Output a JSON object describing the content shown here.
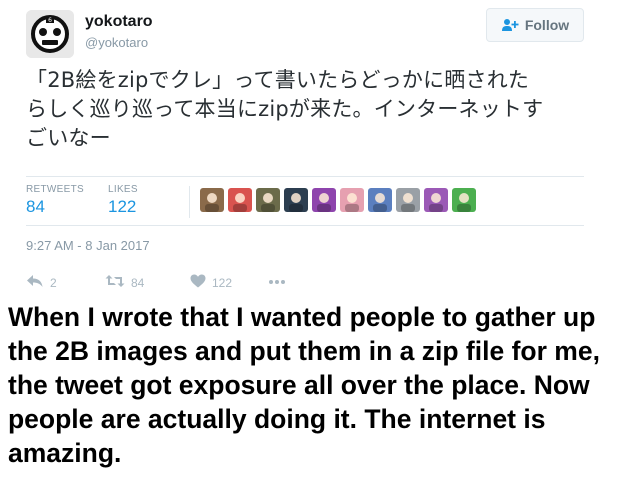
{
  "tweet": {
    "author": {
      "display_name": "yokotaro",
      "handle": "@yokotaro",
      "avatar_icon": "masked-face-avatar"
    },
    "follow_label": "Follow",
    "text_lines": [
      "「2B絵をzipでクレ」って書いたらどっかに晒された",
      "らしく巡り巡って本当にzipが来た。インターネットす",
      "ごいなー"
    ],
    "stats": {
      "retweets_label": "RETWEETS",
      "retweets_count": "84",
      "likes_label": "LIKES",
      "likes_count": "122"
    },
    "liker_avatars": [
      {
        "icon": "liker-avatar-1",
        "color": "#8a6a4a"
      },
      {
        "icon": "liker-avatar-2",
        "color": "#d9534f"
      },
      {
        "icon": "liker-avatar-3",
        "color": "#6b6b4a"
      },
      {
        "icon": "liker-avatar-4",
        "color": "#2c3e50"
      },
      {
        "icon": "liker-avatar-5",
        "color": "#8e44ad"
      },
      {
        "icon": "liker-avatar-6",
        "color": "#e6a0b0"
      },
      {
        "icon": "liker-avatar-7",
        "color": "#5b7fbf"
      },
      {
        "icon": "liker-avatar-8",
        "color": "#9aa0a6"
      },
      {
        "icon": "liker-avatar-9",
        "color": "#9b59b6"
      },
      {
        "icon": "liker-avatar-10",
        "color": "#4caf50"
      }
    ],
    "timestamp": "9:27 AM - 8 Jan 2017",
    "actions": {
      "reply_count": "2",
      "retweet_count": "84",
      "like_count": "122"
    }
  },
  "caption": {
    "text": "When I wrote that I wanted people to gather up the 2B images and put them in a zip file for me, the tweet got exposure all over the place. Now people are actually doing it. The internet is amazing."
  },
  "colors": {
    "accent_blue": "#1b95e0",
    "muted_gray": "#8899a6",
    "icon_gray": "#aab8c2",
    "divider": "#e1e8ed",
    "text_dark": "#292f33"
  }
}
